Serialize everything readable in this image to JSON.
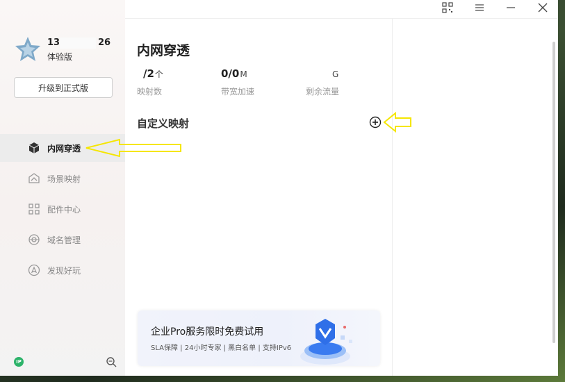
{
  "user": {
    "id_prefix": "13",
    "id_suffix": "26",
    "plan": "体验版",
    "upgrade_label": "升级到正式版"
  },
  "sidebar": {
    "items": [
      {
        "label": "内网穿透",
        "icon": "cube-icon",
        "active": true
      },
      {
        "label": "场景映射",
        "icon": "scene-icon",
        "active": false
      },
      {
        "label": "配件中心",
        "icon": "grid-icon",
        "active": false
      },
      {
        "label": "域名管理",
        "icon": "domain-icon",
        "active": false
      },
      {
        "label": "发现好玩",
        "icon": "compass-icon",
        "active": false
      }
    ],
    "bottom_badge": "IP"
  },
  "titlebar_icons": [
    "qr-code-icon",
    "menu-icon",
    "minimize-icon",
    "close-icon"
  ],
  "main": {
    "title": "内网穿透",
    "stats": [
      {
        "value": "/2",
        "unit": "个",
        "label": "映射数"
      },
      {
        "value": "0/0",
        "unit": "M",
        "label": "带宽加速"
      },
      {
        "value": "",
        "unit": "G",
        "label": "剩余流量"
      }
    ],
    "section_title": "自定义映射"
  },
  "promo": {
    "title": "企业Pro服务限时免费试用",
    "subtitle": "SLA保障 | 24小时专家 | 黑白名单 | 支持IPv6"
  },
  "colors": {
    "accent_arrow": "#f5e600",
    "active_bg": "#ececec",
    "promo_blue": "#3a7bf0",
    "badge_green": "#2db36a"
  }
}
